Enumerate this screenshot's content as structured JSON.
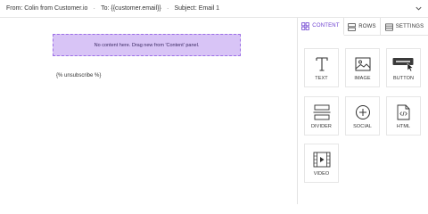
{
  "header": {
    "from": "From: Colin from Customer.io",
    "to": "To: {{customer.email}}",
    "subject": "Subject: Email 1",
    "separator": "·"
  },
  "canvas": {
    "dropzone_text": "No content here. Drag new from 'Content' panel.",
    "unsubscribe_text": "{% unsubscribe %}"
  },
  "panel": {
    "tabs": [
      {
        "label": "CONTENT",
        "icon": "grid-icon",
        "active": true
      },
      {
        "label": "ROWS",
        "icon": "rows-icon",
        "active": false
      },
      {
        "label": "SETTINGS",
        "icon": "settings-icon",
        "active": false
      }
    ],
    "blocks": [
      {
        "label": "TEXT",
        "icon": "text-icon"
      },
      {
        "label": "IMAGE",
        "icon": "image-icon"
      },
      {
        "label": "BUTTON",
        "icon": "button-icon"
      },
      {
        "label": "DIVIDER",
        "icon": "divider-icon"
      },
      {
        "label": "SOCIAL",
        "icon": "social-icon"
      },
      {
        "label": "HTML",
        "icon": "html-icon"
      },
      {
        "label": "VIDEO",
        "icon": "video-icon"
      }
    ]
  },
  "colors": {
    "accent": "#6c3fd0",
    "dropzone_bg": "#d8c4f6",
    "dropzone_border": "#9b6ee6"
  }
}
